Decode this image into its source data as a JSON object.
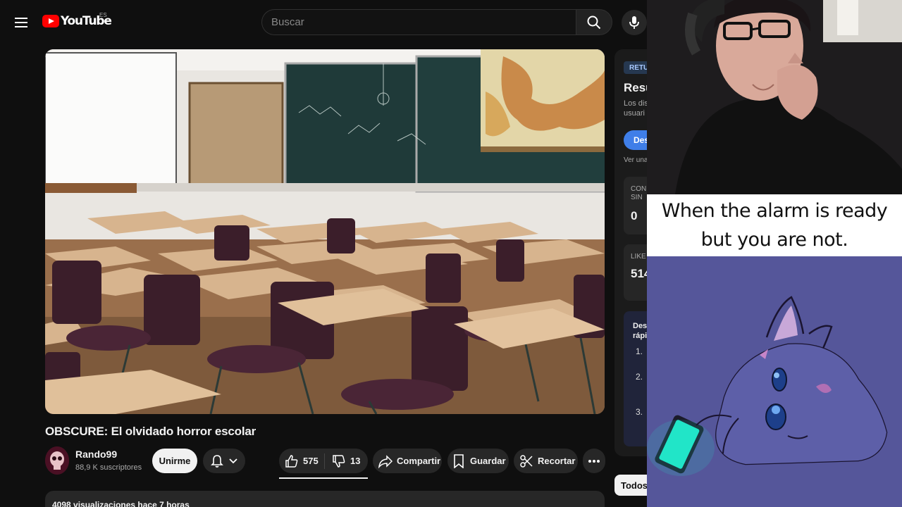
{
  "masthead": {
    "logo_text": "YouTube",
    "region_code": "ES",
    "search_placeholder": "Buscar",
    "icons": [
      "menu-icon",
      "search-icon",
      "mic-icon"
    ]
  },
  "video": {
    "title": "OBSCURE: El olvidado horror escolar",
    "channel": {
      "name": "Rando99",
      "subscribers": "88,9 K suscriptores"
    },
    "join_label": "Unirme",
    "like_count": "575",
    "dislike_count": "13",
    "share_label": "Compartir",
    "save_label": "Guardar",
    "clip_label": "Recortar",
    "views_text": "4098 visualizaciones  hace 7 horas"
  },
  "sidebar": {
    "badge": "RETU",
    "title": "Resu",
    "desc_line1": "Los dis",
    "desc_line2": "usuari",
    "button_label": "Des",
    "link_text": "Ver una",
    "box1_label_line1": "CON",
    "box1_label_line2": "SIN",
    "box1_value": "0",
    "box2_label": "LIKE",
    "box2_value": "514",
    "box3_head_line1": "Desl",
    "box3_head_line2": "rápi",
    "list_numbers": [
      "1.",
      "2.",
      "3."
    ],
    "chip_label": "Todos"
  },
  "overlay": {
    "caption_line1": "When the alarm is ready",
    "caption_line2": "but you are not."
  },
  "colors": {
    "background": "#0f0f0f",
    "youtube_red": "#ff0000",
    "accent_blue": "#3f7ee8",
    "drawing_bg": "#55569a",
    "phone_glow": "#22e6c8"
  }
}
